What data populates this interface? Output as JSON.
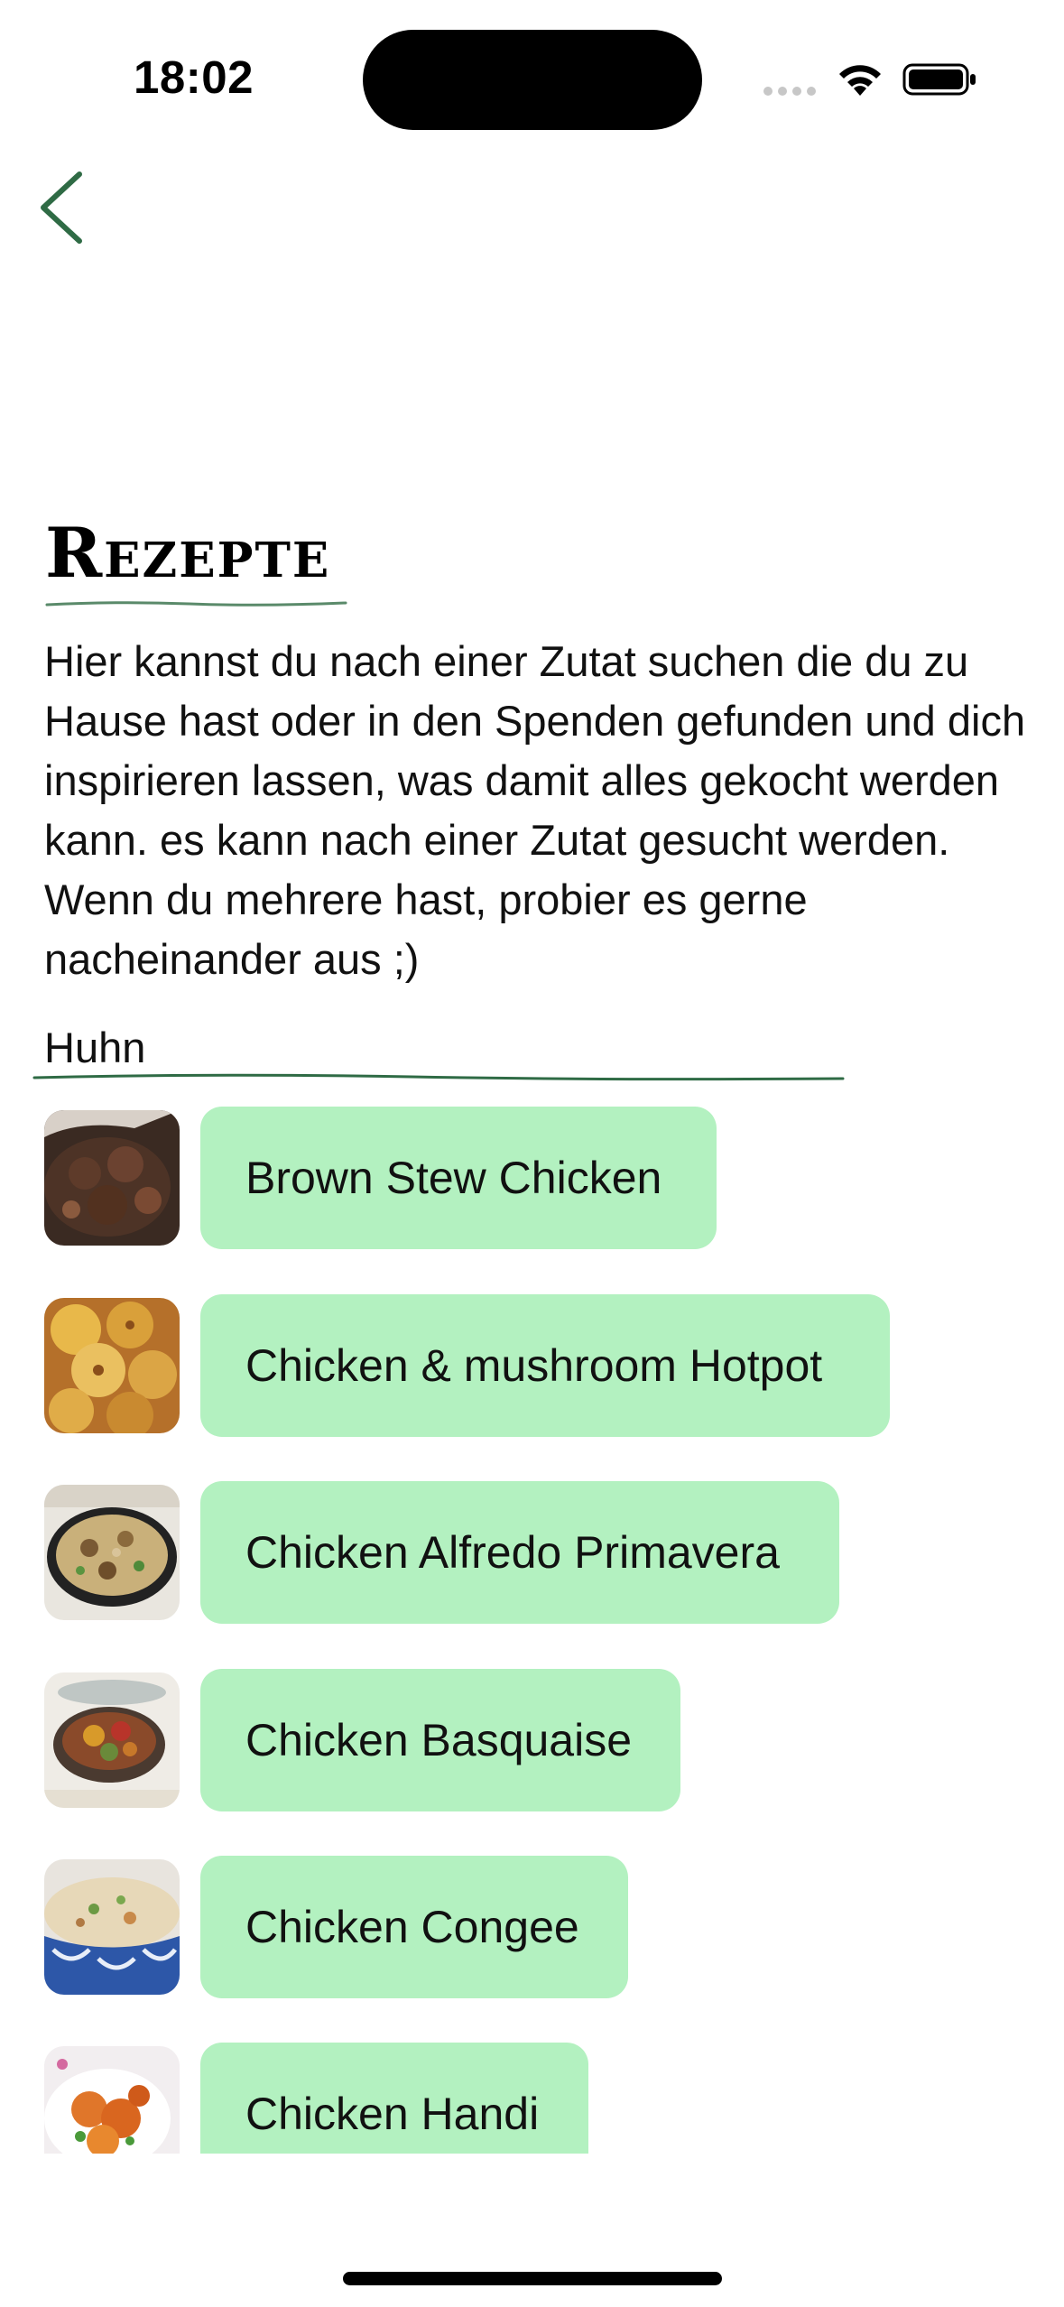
{
  "status_bar": {
    "time": "18:02"
  },
  "nav": {
    "back_icon": "chevron-left-icon",
    "accent_color": "#2f6b45"
  },
  "page": {
    "title": "Rezepte",
    "intro": "Hier kannst du nach einer Zutat suchen die du zu Hause hast oder in den Spenden gefunden und dich inspirieren lassen, was damit alles gekocht werden kann. es kann nach einer Zutat gesucht werden. Wenn du mehrere hast, probier es gerne nacheinander aus ;)"
  },
  "search": {
    "value": "Huhn"
  },
  "colors": {
    "recipe_button_bg": "#b3f1c0"
  },
  "recipes": [
    {
      "name": "Brown Stew Chicken",
      "thumb": "stew-photo"
    },
    {
      "name": "Chicken & mushroom Hotpot",
      "thumb": "hotpot-photo"
    },
    {
      "name": "Chicken Alfredo Primavera",
      "thumb": "pasta-pan-photo"
    },
    {
      "name": "Chicken Basquaise",
      "thumb": "basquaise-pot-photo"
    },
    {
      "name": "Chicken Congee",
      "thumb": "congee-bowl-photo"
    },
    {
      "name": "Chicken Handi",
      "thumb": "handi-plate-photo"
    }
  ]
}
